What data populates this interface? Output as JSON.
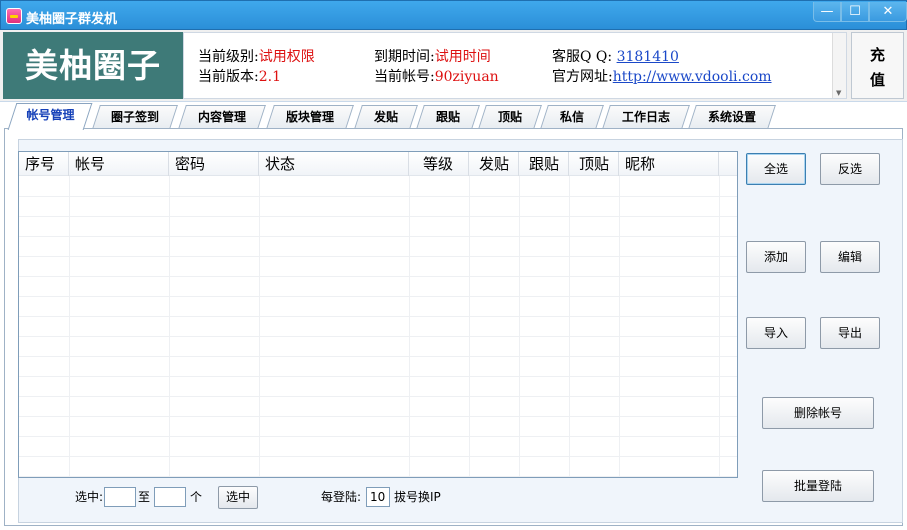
{
  "window": {
    "title": "美柚圈子群发机",
    "min_glyph": "—",
    "max_glyph": "☐",
    "close_glyph": "✕"
  },
  "header": {
    "logo_text": "美柚圈子",
    "level_label": "当前级别:",
    "level_value": "试用权限",
    "version_label": "当前版本:",
    "version_value": "2.1",
    "expire_label": "到期时间:",
    "expire_value": "试用时间",
    "account_label": "当前帐号:",
    "account_value": "90ziyuan",
    "qq_label": "客服Q Q: ",
    "qq_value": "3181410",
    "site_label": "官方网址:",
    "site_value": "http://www.vdooli.com",
    "charge_line1": "充",
    "charge_line2": "值"
  },
  "tabs": [
    {
      "label": "帐号管理",
      "active": true
    },
    {
      "label": "圈子签到",
      "active": false
    },
    {
      "label": "内容管理",
      "active": false
    },
    {
      "label": "版块管理",
      "active": false
    },
    {
      "label": "发贴",
      "active": false
    },
    {
      "label": "跟贴",
      "active": false
    },
    {
      "label": "顶贴",
      "active": false
    },
    {
      "label": "私信",
      "active": false
    },
    {
      "label": "工作日志",
      "active": false
    },
    {
      "label": "系统设置",
      "active": false
    }
  ],
  "table": {
    "columns": [
      "序号",
      "帐号",
      "密码",
      "状态",
      "等级",
      "发贴",
      "跟贴",
      "顶贴",
      "昵称"
    ],
    "rows": []
  },
  "buttons": {
    "select_all": "全选",
    "invert": "反选",
    "add": "添加",
    "edit": "编辑",
    "import": "导入",
    "export": "导出",
    "delete_account": "删除帐号",
    "batch_login": "批量登陆"
  },
  "footer": {
    "select_label": "选中:",
    "range_from": "",
    "to_label": "至",
    "range_to": "",
    "unit_label": "个",
    "select_button": "选中",
    "per_login_label": "每登陆:",
    "per_login_value": "10",
    "dial_ip_label": "拔号换IP"
  }
}
